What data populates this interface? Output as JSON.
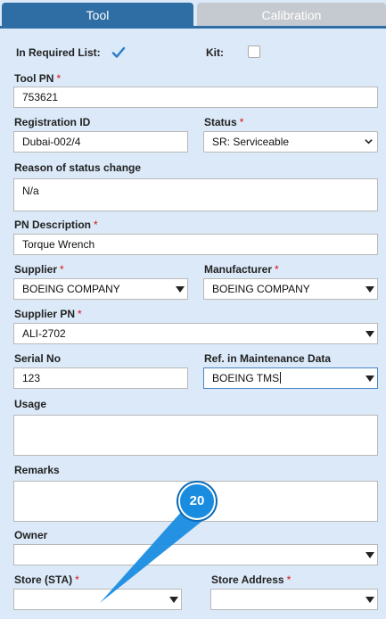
{
  "tabs": [
    {
      "label": "Tool",
      "active": true
    },
    {
      "label": "Calibration",
      "active": false
    }
  ],
  "form": {
    "in_required_list": {
      "label": "In Required List:",
      "checked": true
    },
    "kit": {
      "label": "Kit:",
      "checked": false
    },
    "tool_pn": {
      "label": "Tool PN",
      "required": "*",
      "value": "753621"
    },
    "registration_id": {
      "label": "Registration ID",
      "value": "Dubai-002/4"
    },
    "status": {
      "label": "Status",
      "required": "*",
      "value": "SR: Serviceable"
    },
    "reason": {
      "label": "Reason of status change",
      "value": "N/a"
    },
    "pn_description": {
      "label": "PN Description",
      "required": "*",
      "value": "Torque Wrench"
    },
    "supplier": {
      "label": "Supplier",
      "required": "*",
      "value": "BOEING COMPANY"
    },
    "manufacturer": {
      "label": "Manufacturer",
      "required": "*",
      "value": "BOEING COMPANY"
    },
    "supplier_pn": {
      "label": "Supplier PN",
      "required": "*",
      "value": "ALI-2702"
    },
    "serial_no": {
      "label": "Serial No",
      "value": "123"
    },
    "ref_maintenance": {
      "label": "Ref. in Maintenance Data",
      "value": "BOEING TMS"
    },
    "usage": {
      "label": "Usage",
      "value": ""
    },
    "remarks": {
      "label": "Remarks",
      "value": ""
    },
    "owner": {
      "label": "Owner",
      "value": ""
    },
    "store_sta": {
      "label": "Store (STA)",
      "required": "*",
      "value": ""
    },
    "store_address": {
      "label": "Store Address",
      "required": "*",
      "value": ""
    }
  },
  "callout": {
    "number": "20",
    "color": "#1a8ce0"
  }
}
